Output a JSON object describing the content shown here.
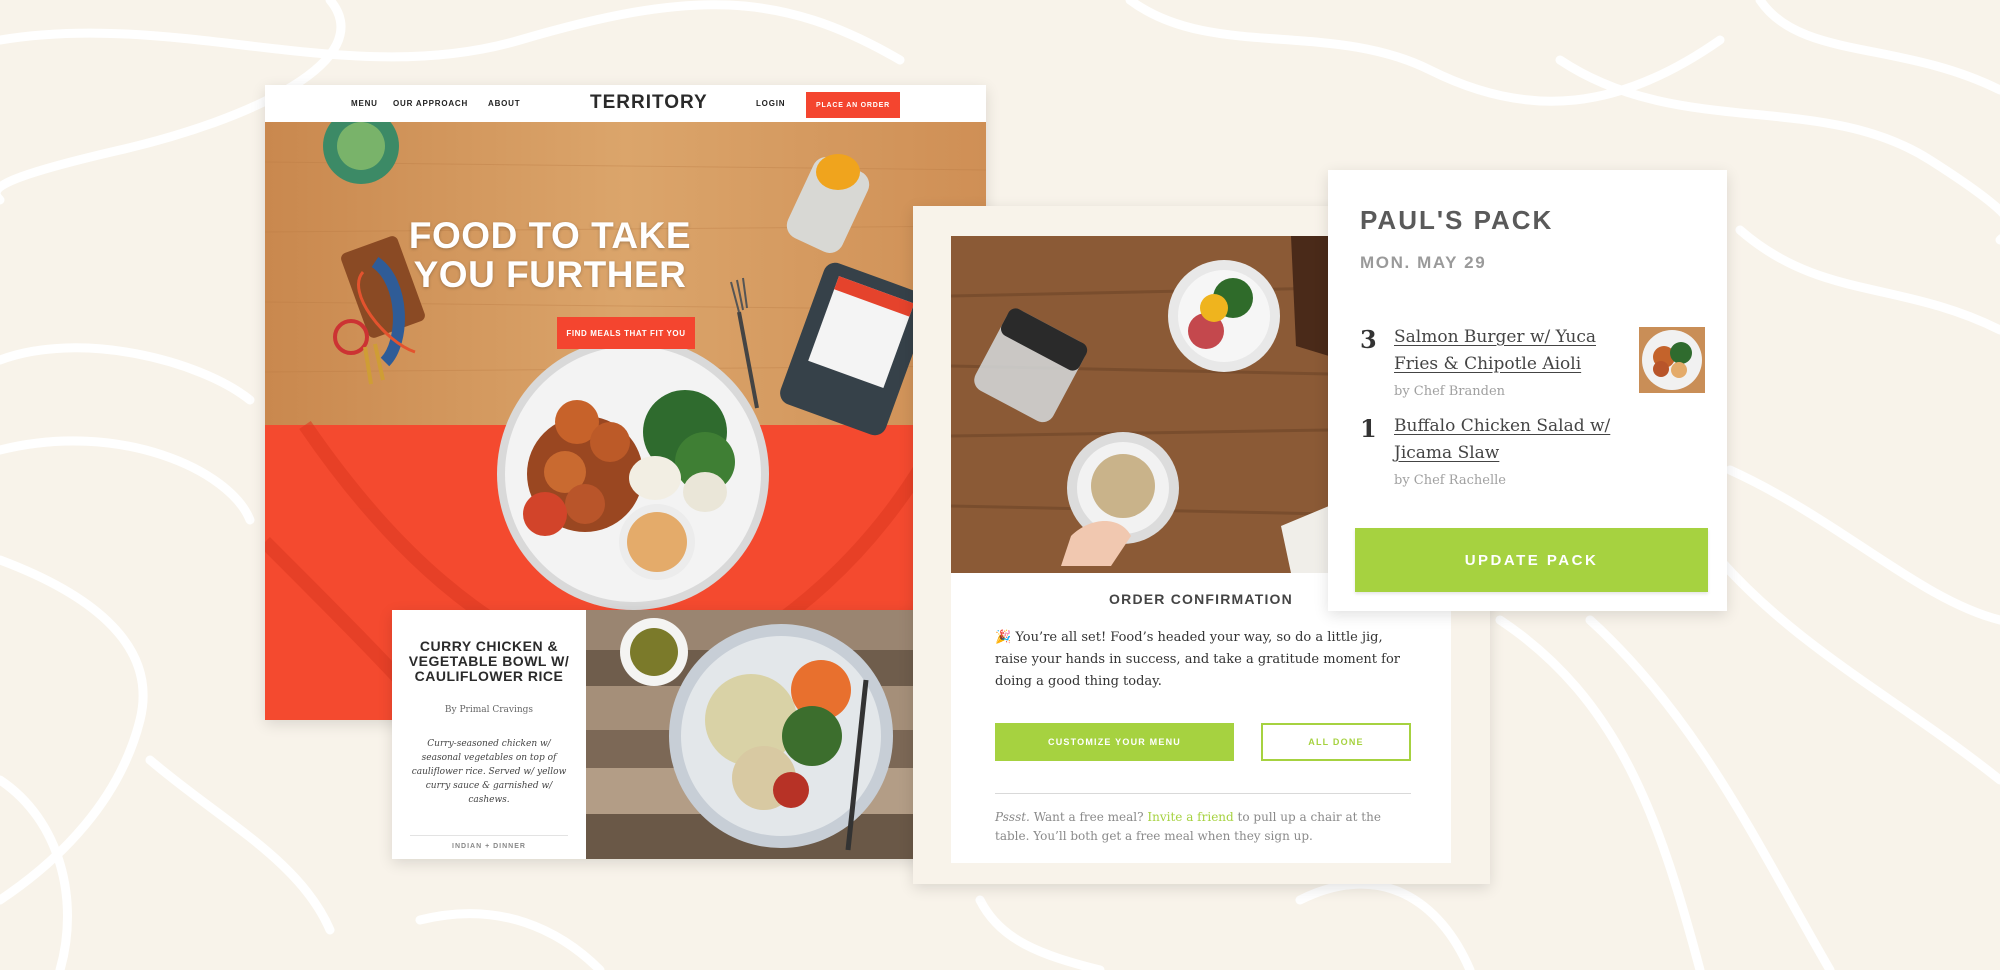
{
  "homepage": {
    "nav": {
      "menu": "MENU",
      "approach": "OUR APPROACH",
      "about": "ABOUT",
      "logo": "TERRITORY",
      "login": "LOGIN",
      "order_button": "PLACE AN ORDER"
    },
    "hero": {
      "title_line1": "FOOD TO TAKE",
      "title_line2": "YOU FURTHER",
      "cta": "FIND MEALS THAT FIT YOU"
    }
  },
  "recipe": {
    "title": "CURRY CHICKEN & VEGETABLE BOWL W/ CAULIFLOWER RICE",
    "by": "By Primal Cravings",
    "description": "Curry-seasoned chicken w/ seasonal vegetables on top of cauliflower rice. Served w/ yellow curry sauce & garnished w/ cashews.",
    "tag": "INDIAN + DINNER"
  },
  "confirmation": {
    "heading": "ORDER CONFIRMATION",
    "emoji": "🎉",
    "body": "You’re all set! Food’s headed your way, so do a little jig, raise your hands in success, and take a gratitude moment for doing a good thing today.",
    "customize_button": "CUSTOMIZE YOUR MENU",
    "done_button": "ALL DONE",
    "footer_pssst": "Pssst.",
    "footer_text1": " Want a free meal? ",
    "footer_link": "Invite a friend",
    "footer_text2": " to pull up a chair at the table. You’ll both get a free meal when they sign up."
  },
  "pack": {
    "title": "PAUL'S PACK",
    "date": "MON. MAY 29",
    "meals": [
      {
        "qty": "3",
        "name": "Salmon Burger w/ Yuca Fries & Chipotle Aioli",
        "chef": "by Chef Branden"
      },
      {
        "qty": "1",
        "name": "Buffalo Chicken Salad w/ Jicama Slaw",
        "chef": "by Chef Rachelle"
      }
    ],
    "update_button": "UPDATE PACK"
  },
  "colors": {
    "background": "#f8f3ea",
    "brand_red": "#f4452f",
    "accent_green": "#a6d240"
  },
  "icons": [
    "party-popper-icon"
  ]
}
